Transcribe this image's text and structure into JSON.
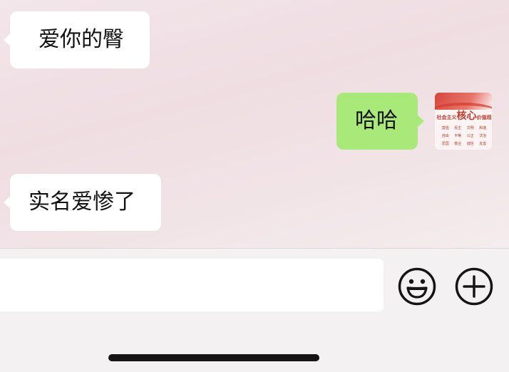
{
  "messages": [
    {
      "direction": "incoming",
      "text": "爱你的臀"
    },
    {
      "direction": "outgoing",
      "text": "哈哈"
    },
    {
      "direction": "incoming",
      "text": "实名爱惨了"
    }
  ],
  "avatar": {
    "prefix": "社会主义",
    "big": "核心",
    "suffix": "价值观",
    "values": [
      "富强",
      "民主",
      "文明",
      "和谐",
      "自由",
      "平等",
      "公正",
      "法治",
      "爱国",
      "敬业",
      "诚信",
      "友善"
    ]
  },
  "input_bar": {
    "message_value": "",
    "emoji_icon": "emoji-smile-icon",
    "plus_icon": "plus-circle-icon"
  },
  "colors": {
    "outgoing_bubble": "#a9e97a",
    "incoming_bubble": "#ffffff",
    "chat_background": "#efdde2",
    "avatar_red": "#c0392b"
  }
}
